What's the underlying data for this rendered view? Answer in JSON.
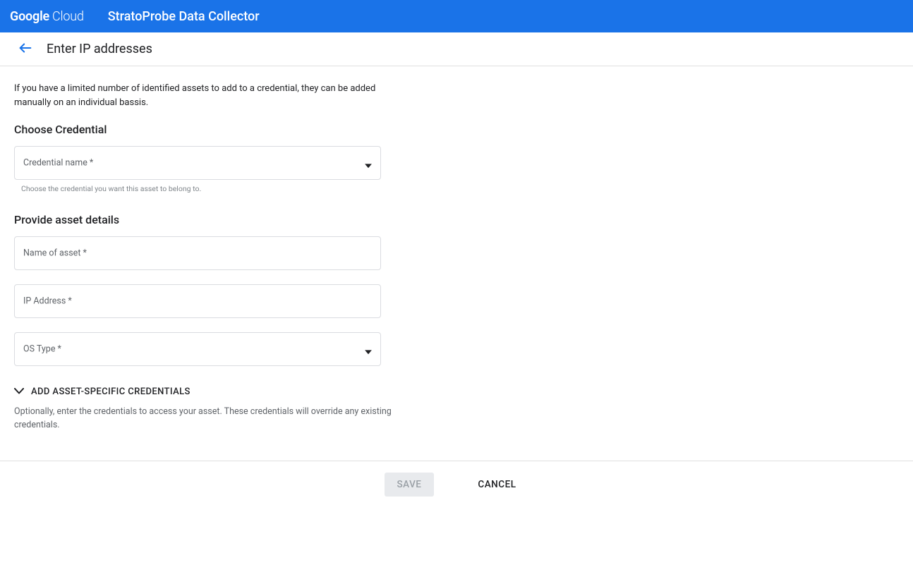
{
  "header": {
    "logo_bold": "Google",
    "logo_thin": "Cloud",
    "app_title": "StratoProbe Data Collector"
  },
  "page": {
    "title": "Enter IP addresses",
    "intro": "If you have a limited number of identified assets to add to a credential, they can be added manually on an individual bassis."
  },
  "credential_section": {
    "heading": "Choose Credential",
    "field_label": "Credential name *",
    "helper": "Choose the credential you want this asset to belong to."
  },
  "asset_section": {
    "heading": "Provide asset details",
    "name_label": "Name of asset *",
    "ip_label": "IP Address *",
    "os_label": "OS Type *"
  },
  "expand": {
    "label": "ADD ASSET-SPECIFIC CREDENTIALS",
    "helper": "Optionally, enter the credentials to access your asset. These credentials will override any existing credentials."
  },
  "footer": {
    "save": "SAVE",
    "cancel": "CANCEL"
  }
}
